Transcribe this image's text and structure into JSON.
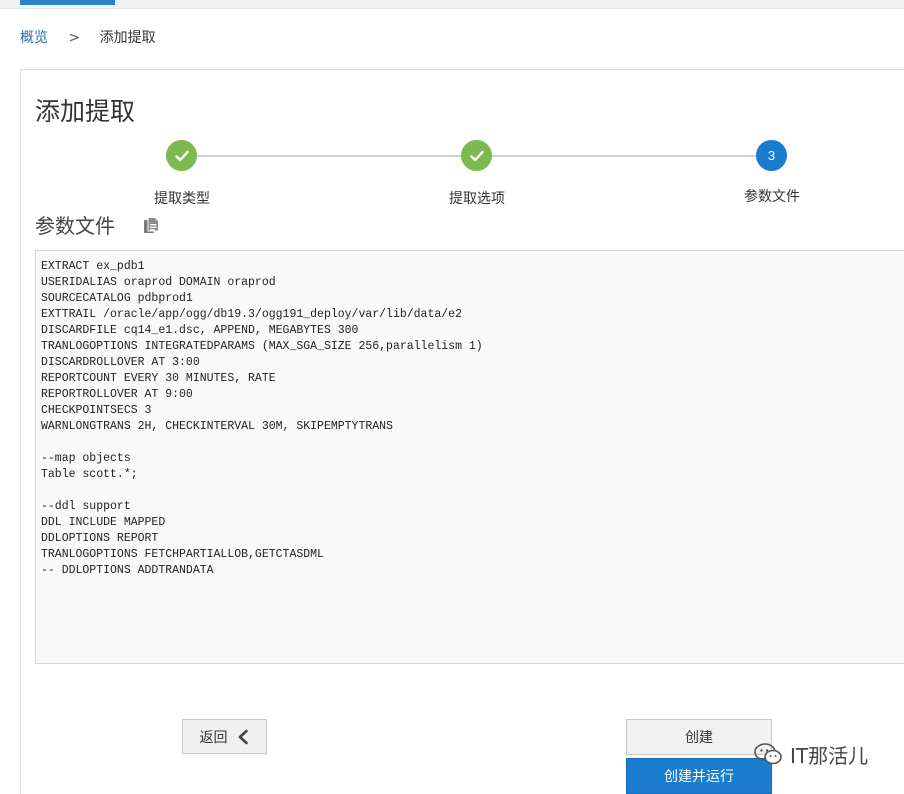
{
  "breadcrumb": {
    "home": "概览",
    "separator": ">",
    "current": "添加提取"
  },
  "page_title": "添加提取",
  "steps": [
    {
      "label": "提取类型",
      "state": "done"
    },
    {
      "label": "提取选项",
      "state": "done"
    },
    {
      "label": "参数文件",
      "number": "3",
      "state": "active"
    }
  ],
  "section": {
    "title": "参数文件",
    "copy_icon": "copy-document-icon"
  },
  "param_file": {
    "content": "EXTRACT ex_pdb1\nUSERIDALIAS oraprod DOMAIN oraprod\nSOURCECATALOG pdbprod1\nEXTTRAIL /oracle/app/ogg/db19.3/ogg191_deploy/var/lib/data/e2\nDISCARDFILE cq14_e1.dsc, APPEND, MEGABYTES 300\nTRANLOGOPTIONS INTEGRATEDPARAMS (MAX_SGA_SIZE 256,parallelism 1)\nDISCARDROLLOVER AT 3:00\nREPORTCOUNT EVERY 30 MINUTES, RATE\nREPORTROLLOVER AT 9:00\nCHECKPOINTSECS 3\nWARNLONGTRANS 2H, CHECKINTERVAL 30M, SKIPEMPTYTRANS\n\n--map objects\nTable scott.*;\n\n--ddl support\nDDL INCLUDE MAPPED\nDDLOPTIONS REPORT\nTRANLOGOPTIONS FETCHPARTIALLOB,GETCTASDML\n-- DDLOPTIONS ADDTRANDATA"
  },
  "buttons": {
    "back": "返回",
    "create": "创建",
    "create_and_run": "创建并运行"
  },
  "watermark": {
    "text": "IT那活儿",
    "icon": "wechat-icon"
  },
  "colors": {
    "accent": "#1a7ccf",
    "done": "#7cba50",
    "link": "#2a6ea3"
  }
}
